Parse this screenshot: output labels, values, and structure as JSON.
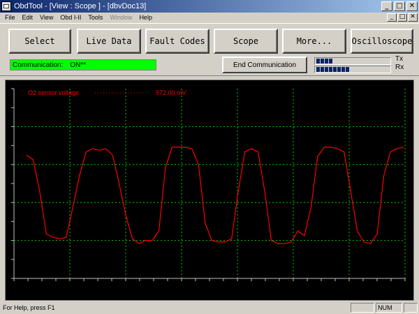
{
  "window": {
    "title": "ObdTool - [View : Scope ] - [dbvDoc13]",
    "controls": {
      "minimize": "_",
      "maximize": "□",
      "close": "✕"
    },
    "icon": "app-icon"
  },
  "menu": {
    "items": [
      "File",
      "Edit",
      "View",
      "Obd I-II",
      "Tools",
      "Window",
      "Help"
    ],
    "disabled": [
      "Window"
    ]
  },
  "toolbar": {
    "buttons": [
      "Select",
      "Live Data",
      "Fault Codes",
      "Scope",
      "More...",
      "Oscilloscope"
    ],
    "communication_label": "Communication:",
    "communication_value": "ON**",
    "communication_color": "#00ff00",
    "end_communication": "End Communication",
    "tx_label": "Tx",
    "rx_label": "Rx",
    "tx_level": 0.25,
    "rx_level": 0.5
  },
  "scope": {
    "signal_name": "O2 sensor voltage",
    "signal_value": "572.00 mV",
    "background": "#000000",
    "grid_color": "#00cc00",
    "trace_color": "#ff0000",
    "grid_cols": 7,
    "grid_rows": 5
  },
  "chart_data": {
    "type": "line",
    "series": [
      {
        "name": "O2 sensor voltage",
        "y": [
          0.78,
          0.75,
          0.55,
          0.28,
          0.26,
          0.25,
          0.26,
          0.45,
          0.65,
          0.8,
          0.82,
          0.81,
          0.82,
          0.78,
          0.6,
          0.4,
          0.25,
          0.22,
          0.24,
          0.24,
          0.3,
          0.7,
          0.83,
          0.83,
          0.83,
          0.82,
          0.72,
          0.35,
          0.24,
          0.23,
          0.23,
          0.25,
          0.55,
          0.8,
          0.82,
          0.8,
          0.55,
          0.24,
          0.22,
          0.22,
          0.23,
          0.3,
          0.27,
          0.45,
          0.77,
          0.83,
          0.83,
          0.82,
          0.8,
          0.55,
          0.3,
          0.23,
          0.22,
          0.28,
          0.65,
          0.8,
          0.82,
          0.83
        ]
      }
    ],
    "ylim": [
      0,
      1.2
    ],
    "grid": true
  },
  "status": {
    "help_text": "For Help, press F1",
    "num": "NUM"
  }
}
